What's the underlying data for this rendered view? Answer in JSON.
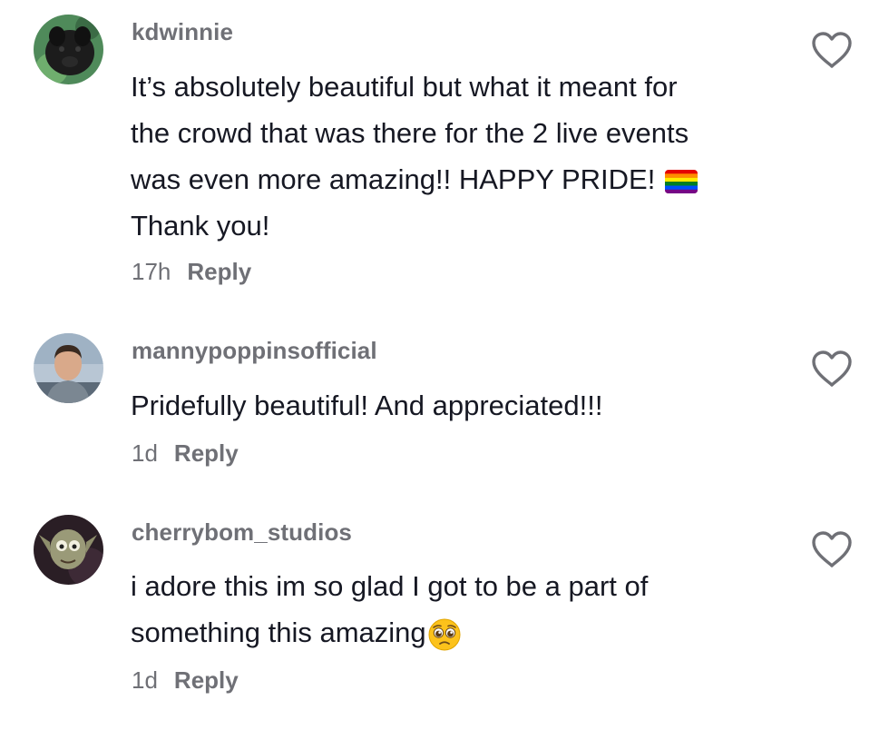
{
  "comments": [
    {
      "username": "kdwinnie",
      "lines": [
        "It’s absolutely beautiful but what it meant for",
        "the crowd that was there for the 2 live events",
        "was even more amazing!! HAPPY PRIDE!",
        "Thank you!"
      ],
      "emoji": "rainbow-flag",
      "time": "17h",
      "reply_label": "Reply"
    },
    {
      "username": "mannypoppinsofficial",
      "lines": [
        "Pridefully beautiful! And appreciated!!!"
      ],
      "time": "1d",
      "reply_label": "Reply"
    },
    {
      "username": "cherrybom_studios",
      "lines": [
        "i adore this im so glad I got to be a part of",
        "something this amazing"
      ],
      "emoji": "pleading-face",
      "time": "1d",
      "reply_label": "Reply"
    }
  ],
  "icons": {
    "like": "heart-outline-icon"
  },
  "colors": {
    "text": "#161823",
    "muted": "#6f7076",
    "background": "#ffffff"
  }
}
